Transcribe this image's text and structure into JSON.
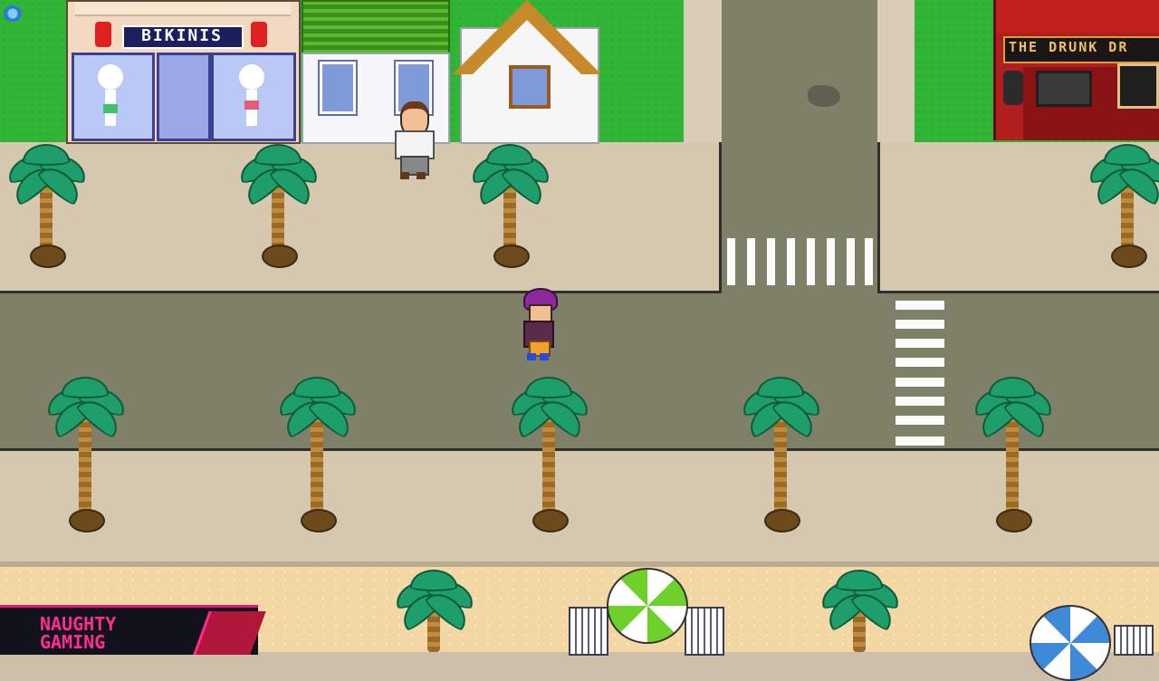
{
  "scene": {
    "shop_bikini_sign": "BIKINIS",
    "pub_sign": "THE DRUNK DR",
    "logo_line1": "NAUGHTY",
    "logo_line2": "GAMING"
  },
  "colors": {
    "grass": "#31b536",
    "road": "#7f8068",
    "sidewalk": "#d6c8ae",
    "sand": "#f3d7a4",
    "pub_red": "#c0201e",
    "logo_pink": "#ff2d92"
  },
  "icons": {
    "player": "player-character-icon",
    "npc": "npc-man-icon",
    "palm": "palm-tree-icon",
    "umbrella": "beach-umbrella-icon"
  }
}
